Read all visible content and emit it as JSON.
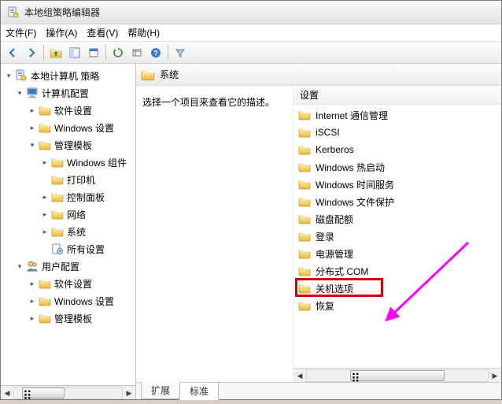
{
  "window": {
    "title": "本地组策略编辑器"
  },
  "menu": {
    "file": "文件(F)",
    "action": "操作(A)",
    "view": "查看(V)",
    "help": "帮助(H)"
  },
  "toolbar_icons": {
    "back": "back-arrow",
    "forward": "forward-arrow",
    "up": "up-folder",
    "view_console": "console-tree",
    "props": "properties",
    "refresh": "refresh",
    "export": "export-list",
    "help_icon": "help",
    "filter": "filter"
  },
  "tree": [
    {
      "d": 0,
      "icon": "policy",
      "exp": "open",
      "label": "本地计算机 策略"
    },
    {
      "d": 1,
      "icon": "computer",
      "exp": "open",
      "label": "计算机配置"
    },
    {
      "d": 2,
      "icon": "folder",
      "exp": "closed",
      "label": "软件设置"
    },
    {
      "d": 2,
      "icon": "folder",
      "exp": "closed",
      "label": "Windows 设置"
    },
    {
      "d": 2,
      "icon": "folder",
      "exp": "open",
      "label": "管理模板"
    },
    {
      "d": 3,
      "icon": "folder",
      "exp": "closed",
      "label": "Windows 组件"
    },
    {
      "d": 3,
      "icon": "folder",
      "exp": "none",
      "label": "打印机"
    },
    {
      "d": 3,
      "icon": "folder",
      "exp": "closed",
      "label": "控制面板"
    },
    {
      "d": 3,
      "icon": "folder",
      "exp": "closed",
      "label": "网络"
    },
    {
      "d": 3,
      "icon": "folder",
      "exp": "closed",
      "label": "系统"
    },
    {
      "d": 3,
      "icon": "settings",
      "exp": "none",
      "label": "所有设置"
    },
    {
      "d": 1,
      "icon": "user",
      "exp": "open",
      "label": "用户配置"
    },
    {
      "d": 2,
      "icon": "folder",
      "exp": "closed",
      "label": "软件设置"
    },
    {
      "d": 2,
      "icon": "folder",
      "exp": "closed",
      "label": "Windows 设置"
    },
    {
      "d": 2,
      "icon": "folder",
      "exp": "closed",
      "label": "管理模板"
    }
  ],
  "right": {
    "header": "系统",
    "desc": "选择一个项目来查看它的描述。",
    "column": "设置",
    "items": [
      "Internet 通信管理",
      "iSCSI",
      "Kerberos",
      "Windows 热启动",
      "Windows 时间服务",
      "Windows 文件保护",
      "磁盘配额",
      "登录",
      "电源管理",
      "分布式 COM",
      "关机选项",
      "恢复"
    ],
    "highlight_index": 10
  },
  "tabs": {
    "extended": "扩展",
    "standard": "标准"
  },
  "colors": {
    "highlight": "#d50000",
    "arrow": "#ff00ff"
  }
}
